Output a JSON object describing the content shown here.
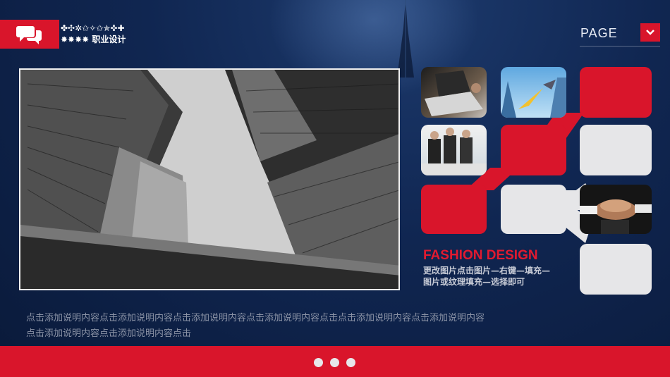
{
  "header": {
    "title_line1": "✤✣✲✩✧✩✯✜✚",
    "title_line2": "✸✸✸✸ 职业设计",
    "icon": "speech-bubbles-icon"
  },
  "page": {
    "label": "PAGE",
    "button_icon": "chevron-down-icon"
  },
  "fashion": {
    "title": "FASHION DESIGN",
    "desc_line1": "更改图片点击图片—右键—填充—",
    "desc_line2": "图片或纹理填充—选择即可"
  },
  "body_text": {
    "line1": "点击添加说明内容点击添加说明内容点击添加说明内容点击添加说明内容点击点击添加说明内容点击添加说明内容",
    "line2": "点击添加说明内容点击添加说明内容点击"
  },
  "colors": {
    "accent": "#d9152b",
    "background": "#102651",
    "tile_gray": "#e6e6e8"
  },
  "footer": {
    "dots": 3
  }
}
